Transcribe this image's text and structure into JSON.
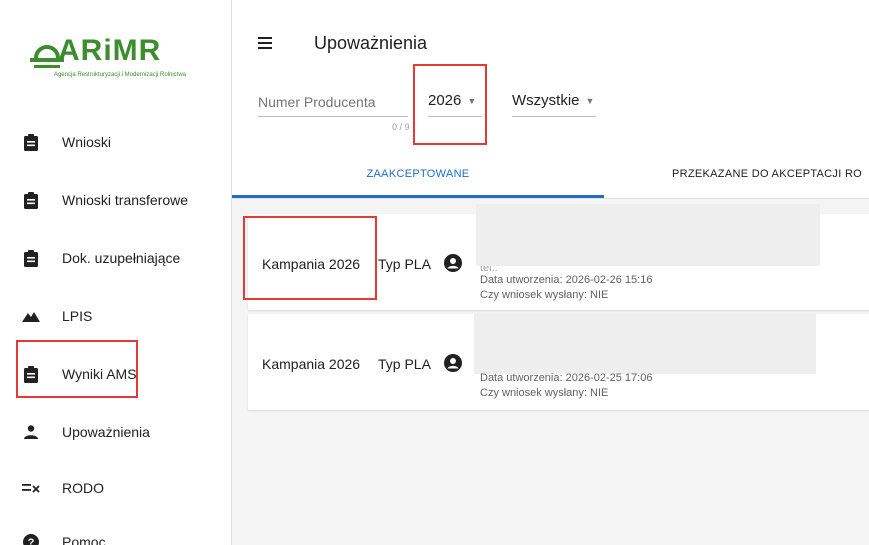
{
  "logo": {
    "text": "ARiMR",
    "subtitle": "Agencja Restrukturyzacji i Modernizacji Rolnictwa"
  },
  "sidebar": {
    "items": [
      {
        "label": "Wnioski",
        "icon": "clipboard-icon"
      },
      {
        "label": "Wnioski transferowe",
        "icon": "clipboard-icon"
      },
      {
        "label": "Dok. uzupełniające",
        "icon": "clipboard-icon"
      },
      {
        "label": "LPIS",
        "icon": "terrain-icon"
      },
      {
        "label": "Wyniki AMS",
        "icon": "clipboard-icon"
      },
      {
        "label": "Upoważnienia",
        "icon": "person-icon"
      },
      {
        "label": "RODO",
        "icon": "rule-icon"
      },
      {
        "label": "Pomoc",
        "icon": "help-icon"
      }
    ]
  },
  "header": {
    "title": "Upoważnienia",
    "menu_icon": "hamburger-menu-icon"
  },
  "filters": {
    "producer_label": "Numer Producenta",
    "producer_counter": "0 / 9",
    "year_value": "2026",
    "status_value": "Wszystkie"
  },
  "tabs": [
    {
      "label": "ZAAKCEPTOWANE",
      "active": true
    },
    {
      "label": "PRZEKAZANE DO AKCEPTACJI RO",
      "active": false
    }
  ],
  "cards": [
    {
      "campaign": "Kampania 2026",
      "type": "Typ PLA",
      "partial_line": "tel.: ",
      "created": "Data utworzenia: 2026-02-26 15:16",
      "sent": "Czy wniosek wysłany: NIE"
    },
    {
      "campaign": "Kampania 2026",
      "type": "Typ PLA",
      "created": "Data utworzenia: 2026-02-25 17:06",
      "sent": "Czy wniosek wysłany: NIE"
    }
  ],
  "colors": {
    "brand_green": "#3d8d2f",
    "accent_blue": "#1e6ec8",
    "highlight_red": "#e53935"
  }
}
